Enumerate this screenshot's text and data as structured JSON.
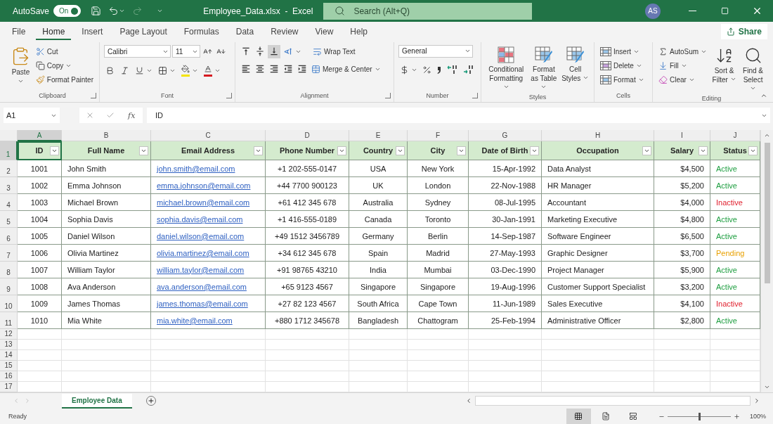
{
  "title_bar": {
    "autosave": {
      "label": "AutoSave",
      "toggle": "On",
      "on": true
    },
    "title": "Employee_Data.xlsx  -  Excel",
    "search": {
      "placeholder": "Search (Alt+Q)"
    },
    "avatar": "AS"
  },
  "menu_tabs": [
    {
      "label": "File",
      "selected": false
    },
    {
      "label": "Home",
      "selected": true
    },
    {
      "label": "Insert",
      "selected": false
    },
    {
      "label": "Page Layout",
      "selected": false
    },
    {
      "label": "Formulas",
      "selected": false
    },
    {
      "label": "Data",
      "selected": false
    },
    {
      "label": "Review",
      "selected": false
    },
    {
      "label": "View",
      "selected": false
    },
    {
      "label": "Help",
      "selected": false
    }
  ],
  "share": "Share",
  "ribbon": {
    "clipboard": {
      "label": "Clipboard",
      "paste": "Paste",
      "cut": "Cut",
      "copy": "Copy",
      "format_painter": "Format Painter"
    },
    "font": {
      "label": "Font",
      "font_name": "Calibri",
      "font_size": "11"
    },
    "alignment": {
      "label": "Alignment",
      "wrap_text": "Wrap Text",
      "merge_center": "Merge & Center"
    },
    "number": {
      "label": "Number",
      "format": "General"
    },
    "styles": {
      "label": "Styles",
      "buttons": [
        "Conditional Formatting",
        "Format as Table",
        "Cell Styles"
      ]
    },
    "cells": {
      "label": "Cells",
      "buttons": [
        "Insert",
        "Delete",
        "Format"
      ]
    },
    "editing": {
      "label": "Editing",
      "autosum": "AutoSum",
      "fill": "Fill",
      "clear": "Clear",
      "sort_filter": "Sort & Filter",
      "find_select": "Find & Select"
    }
  },
  "formula_bar": {
    "name_box": "A1",
    "function_button": "fx",
    "formula": "ID"
  },
  "grid": {
    "columns": [
      {
        "letter": "A",
        "header": "ID",
        "kind": "text",
        "selected": true
      },
      {
        "letter": "B",
        "header": "Full Name",
        "kind": "text",
        "selected": false
      },
      {
        "letter": "C",
        "header": "Email Address",
        "kind": "link",
        "selected": false
      },
      {
        "letter": "D",
        "header": "Phone Number",
        "kind": "text",
        "selected": false
      },
      {
        "letter": "E",
        "header": "Country",
        "kind": "text",
        "selected": false
      },
      {
        "letter": "F",
        "header": "City",
        "kind": "text",
        "selected": false
      },
      {
        "letter": "G",
        "header": "Date of Birth",
        "kind": "text",
        "selected": false
      },
      {
        "letter": "H",
        "header": "Occupation",
        "kind": "text",
        "selected": false
      },
      {
        "letter": "I",
        "header": "Salary",
        "kind": "text",
        "selected": false
      },
      {
        "letter": "J",
        "header": "Status",
        "kind": "status",
        "selected": false
      }
    ],
    "header_row": {
      "number": "1",
      "selected": true
    },
    "rows": [
      {
        "number": "2",
        "cells": [
          "1001",
          "John Smith",
          "john.smith@email.com",
          "+1 202-555-0147",
          "USA",
          "New York",
          "15-Apr-1992",
          "Data Analyst",
          "$4,500"
        ],
        "status": {
          "text": "Active",
          "color": "#1e9e40"
        }
      },
      {
        "number": "3",
        "cells": [
          "1002",
          "Emma Johnson",
          "emma.johnson@email.com",
          "+44 7700 900123",
          "UK",
          "London",
          "22-Nov-1988",
          "HR Manager",
          "$5,200"
        ],
        "status": {
          "text": "Active",
          "color": "#1e9e40"
        }
      },
      {
        "number": "4",
        "cells": [
          "1003",
          "Michael Brown",
          "michael.brown@email.com",
          "+61 412 345 678",
          "Australia",
          "Sydney",
          "08-Jul-1995",
          "Accountant",
          "$4,000"
        ],
        "status": {
          "text": "Inactive",
          "color": "#e0202e"
        }
      },
      {
        "number": "5",
        "cells": [
          "1004",
          "Sophia Davis",
          "sophia.davis@email.com",
          "+1 416-555-0189",
          "Canada",
          "Toronto",
          "30-Jan-1991",
          "Marketing Executive",
          "$4,800"
        ],
        "status": {
          "text": "Active",
          "color": "#1e9e40"
        }
      },
      {
        "number": "6",
        "cells": [
          "1005",
          "Daniel Wilson",
          "daniel.wilson@email.com",
          "+49 1512 3456789",
          "Germany",
          "Berlin",
          "14-Sep-1987",
          "Software Engineer",
          "$6,500"
        ],
        "status": {
          "text": "Active",
          "color": "#1e9e40"
        }
      },
      {
        "number": "7",
        "cells": [
          "1006",
          "Olivia Martinez",
          "olivia.martinez@email.com",
          "+34 612 345 678",
          "Spain",
          "Madrid",
          "27-May-1993",
          "Graphic Designer",
          "$3,700"
        ],
        "status": {
          "text": "Pending",
          "color": "#e8a000"
        }
      },
      {
        "number": "8",
        "cells": [
          "1007",
          "William Taylor",
          "william.taylor@email.com",
          "+91 98765 43210",
          "India",
          "Mumbai",
          "03-Dec-1990",
          "Project Manager",
          "$5,900"
        ],
        "status": {
          "text": "Active",
          "color": "#1e9e40"
        }
      },
      {
        "number": "9",
        "cells": [
          "1008",
          "Ava Anderson",
          "ava.anderson@email.com",
          "+65 9123 4567",
          "Singapore",
          "Singapore",
          "19-Aug-1996",
          "Customer Support Specialist",
          "$3,200"
        ],
        "status": {
          "text": "Active",
          "color": "#1e9e40"
        }
      },
      {
        "number": "10",
        "cells": [
          "1009",
          "James Thomas",
          "james.thomas@email.com",
          "+27 82 123 4567",
          "South Africa",
          "Cape Town",
          "11-Jun-1989",
          "Sales Executive",
          "$4,100"
        ],
        "status": {
          "text": "Inactive",
          "color": "#e0202e"
        }
      },
      {
        "number": "11",
        "cells": [
          "1010",
          "Mia White",
          "mia.white@email.com",
          "+880 1712 345678",
          "Bangladesh",
          "Chattogram",
          "25-Feb-1994",
          "Administrative Officer",
          "$2,800"
        ],
        "status": {
          "text": "Active",
          "color": "#1e9e40"
        }
      }
    ],
    "empty_rows": [
      "12",
      "13",
      "14",
      "15",
      "16",
      "17"
    ]
  },
  "sheet_tabs": [
    {
      "label": "Employee Data",
      "selected": true
    }
  ],
  "status_bar": {
    "status": "Ready",
    "views": [
      {
        "selected": true
      },
      {
        "selected": false
      },
      {
        "selected": false
      }
    ],
    "zoom": {
      "level": 0.5,
      "reading": "100%"
    }
  }
}
